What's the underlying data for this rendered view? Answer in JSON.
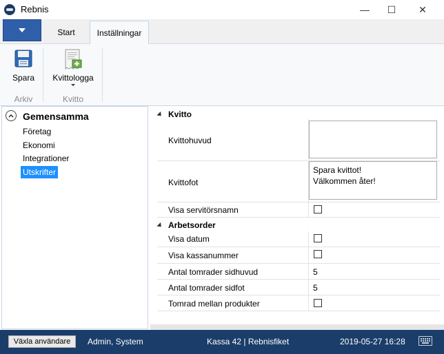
{
  "window": {
    "title": "Rebnis",
    "min": "—",
    "max": "☐",
    "close": "✕"
  },
  "ribbon": {
    "tabs": [
      "Start",
      "Inställningar"
    ],
    "groups": [
      {
        "label": "Arkiv",
        "buttons": [
          {
            "label": "Spara"
          }
        ]
      },
      {
        "label": "Kvitto",
        "buttons": [
          {
            "label": "Kvittologga"
          }
        ]
      }
    ]
  },
  "nav": {
    "group": "Gemensamma",
    "items": [
      "Företag",
      "Ekonomi",
      "Integrationer",
      "Utskrifter"
    ]
  },
  "settings": {
    "categories": [
      {
        "name": "Kvitto",
        "rows": [
          {
            "label": "Kvittohuvud",
            "value": ""
          },
          {
            "label": "Kvittofot",
            "value": "Spara kvittot!\nVälkommen åter!"
          },
          {
            "label": "Visa servitörsnamn",
            "checked": false
          }
        ]
      },
      {
        "name": "Arbetsorder",
        "rows": [
          {
            "label": "Visa datum",
            "checked": false
          },
          {
            "label": "Visa kassanummer",
            "checked": false
          },
          {
            "label": "Antal tomrader sidhuvud",
            "value": "5"
          },
          {
            "label": "Antal tomrader sidfot",
            "value": "5"
          },
          {
            "label": "Tomrad mellan produkter",
            "checked": false
          }
        ]
      }
    ]
  },
  "statusbar": {
    "switch_user": "Växla användare",
    "user": "Admin, System",
    "register": "Kassa 42 | Rebnisfiket",
    "datetime": "2019-05-27 16:28"
  },
  "colors": {
    "accent": "#2f5fa8",
    "status_bar": "#1b3d6a",
    "selection": "#1e90ff"
  }
}
